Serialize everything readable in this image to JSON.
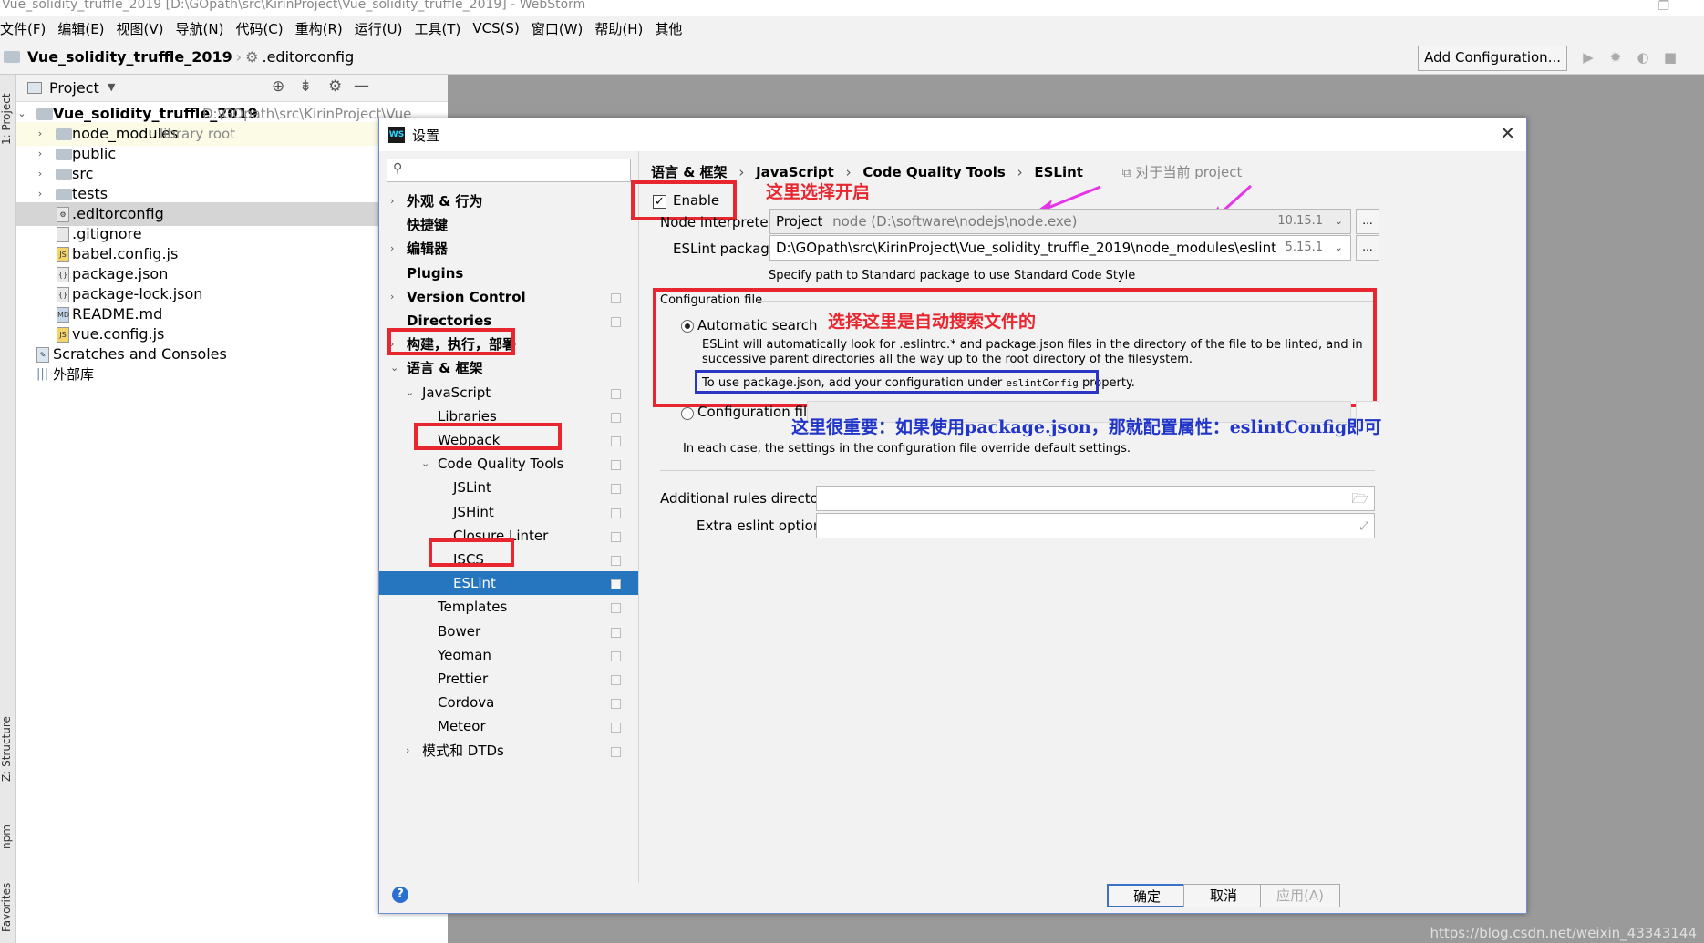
{
  "window": {
    "title": "Vue_solidity_truffle_2019 [D:\\GOpath\\src\\KirinProject\\Vue_solidity_truffle_2019] - WebStorm"
  },
  "menu": [
    "文件(F)",
    "编辑(E)",
    "视图(V)",
    "导航(N)",
    "代码(C)",
    "重构(R)",
    "运行(U)",
    "工具(T)",
    "VCS(S)",
    "窗口(W)",
    "帮助(H)",
    "其他"
  ],
  "navbar": {
    "project": "Vue_solidity_truffle_2019",
    "file": ".editorconfig",
    "add_config": "Add Configuration..."
  },
  "leftstrip": {
    "project_tab": "1: Project",
    "structure_tab": "Z: Structure",
    "npm_tab": "npm",
    "favorites_tab": "Favorites"
  },
  "project_panel": {
    "title": "Project",
    "root_name": "Vue_solidity_truffle_2019",
    "root_path": "D:\\GOpath\\src\\KirinProject\\Vue",
    "items": [
      {
        "name": "node_modules",
        "hint": "library root",
        "kind": "folder"
      },
      {
        "name": "public",
        "kind": "folder"
      },
      {
        "name": "src",
        "kind": "folder"
      },
      {
        "name": "tests",
        "kind": "folder"
      },
      {
        "name": ".editorconfig",
        "kind": "file"
      },
      {
        "name": ".gitignore",
        "kind": "file"
      },
      {
        "name": "babel.config.js",
        "kind": "file"
      },
      {
        "name": "package.json",
        "kind": "file"
      },
      {
        "name": "package-lock.json",
        "kind": "file"
      },
      {
        "name": "README.md",
        "kind": "file"
      },
      {
        "name": "vue.config.js",
        "kind": "file"
      }
    ],
    "scratches": "Scratches and Consoles",
    "external_libs": "外部库"
  },
  "dialog": {
    "title": "设置",
    "breadcrumb": [
      "语言 & 框架",
      "JavaScript",
      "Code Quality Tools",
      "ESLint"
    ],
    "scope": "对于当前 project",
    "sidebar": [
      {
        "label": "外观 & 行为",
        "arrow": "right",
        "indent": 0,
        "bold": true
      },
      {
        "label": "快捷键",
        "indent": 0,
        "bold": true
      },
      {
        "label": "编辑器",
        "arrow": "right",
        "indent": 0,
        "bold": true
      },
      {
        "label": "Plugins",
        "indent": 0,
        "bold": true
      },
      {
        "label": "Version Control",
        "arrow": "right",
        "indent": 0,
        "bold": true,
        "copy": true
      },
      {
        "label": "Directories",
        "indent": 0,
        "bold": true,
        "copy": true
      },
      {
        "label": "构建，执行，部署",
        "arrow": "right",
        "indent": 0,
        "bold": true
      },
      {
        "label": "语言 & 框架",
        "arrow": "down",
        "indent": 0,
        "bold": true
      },
      {
        "label": "JavaScript",
        "arrow": "down",
        "indent": 1,
        "copy": true
      },
      {
        "label": "Libraries",
        "indent": 2,
        "copy": true
      },
      {
        "label": "Webpack",
        "indent": 2,
        "copy": true
      },
      {
        "label": "Code Quality Tools",
        "arrow": "down",
        "indent": 2,
        "copy": true
      },
      {
        "label": "JSLint",
        "indent": 3,
        "copy": true
      },
      {
        "label": "JSHint",
        "indent": 3,
        "copy": true
      },
      {
        "label": "Closure Linter",
        "indent": 3,
        "copy": true
      },
      {
        "label": "JSCS",
        "indent": 3,
        "copy": true
      },
      {
        "label": "ESLint",
        "indent": 3,
        "copy": true,
        "selected": true
      },
      {
        "label": "Templates",
        "indent": 2,
        "copy": true
      },
      {
        "label": "Bower",
        "indent": 2,
        "copy": true
      },
      {
        "label": "Yeoman",
        "indent": 2,
        "copy": true
      },
      {
        "label": "Prettier",
        "indent": 2,
        "copy": true
      },
      {
        "label": "Cordova",
        "indent": 2,
        "copy": true
      },
      {
        "label": "Meteor",
        "indent": 2,
        "copy": true
      },
      {
        "label": "模式和 DTDs",
        "arrow": "right",
        "indent": 1,
        "copy": true
      }
    ],
    "enable_label": "Enable",
    "enable_checked": true,
    "node_interpreter_label": "Node interpreter:",
    "node_interpreter_prefix": "Project",
    "node_interpreter_value": "node (D:\\software\\nodejs\\node.exe)",
    "node_version": "10.15.1",
    "eslint_package_label": "ESLint package:",
    "eslint_package_value": "D:\\GOpath\\src\\KirinProject\\Vue_solidity_truffle_2019\\node_modules\\eslint",
    "eslint_version": "5.15.1",
    "standard_hint": "Specify path to Standard package to use Standard Code Style",
    "config_file_title": "Configuration file",
    "auto_search_label": "Automatic search",
    "auto_search_desc": "ESLint will automatically look for .eslintrc.* and package.json files in the directory of the file to be linted, and in successive parent directories all the way up to the root directory of the filesystem.",
    "package_json_note_a": "To use package.json, add your configuration under",
    "package_json_note_code": "eslintConfig",
    "package_json_note_b": "property.",
    "config_file_label": "Configuration file:",
    "override_note": "In each case, the settings in the configuration file override default settings.",
    "additional_rules_label": "Additional rules directory:",
    "extra_options_label": "Extra eslint options:",
    "ok": "确定",
    "cancel": "取消",
    "apply": "应用(A)"
  },
  "annotations": {
    "enable_note": "这里选择开启",
    "auto_note": "选择这里是自动搜索文件的",
    "important_note": "这里很重要：如果使用package.json，那就配置属性：eslintConfig即可",
    "red_color": "#e8262f",
    "blue_color": "#2c36c2",
    "arrow_color": "#e535e9"
  },
  "watermark": "https://blog.csdn.net/weixin_43343144",
  "colors": {
    "selection": "#2675bf",
    "annotation_red": "#e8262f",
    "annotation_blue": "#2135c8"
  }
}
